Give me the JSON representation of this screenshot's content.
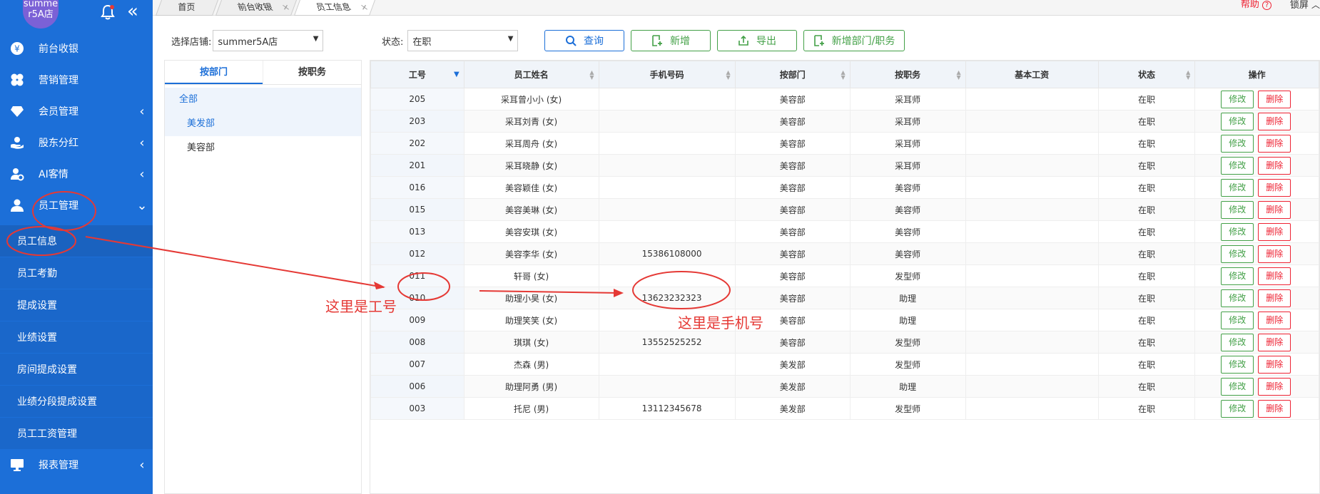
{
  "sidebar": {
    "store_avatar": "summer5A店",
    "avatar_line1": "summe",
    "avatar_line2": "r5A店",
    "bell_icon": "bell-icon",
    "collapse_icon": "double-chevron-left-icon",
    "menu": [
      {
        "label": "前台收银",
        "icon": "yen-icon",
        "arrow": ""
      },
      {
        "label": "营销管理",
        "icon": "clover-icon",
        "arrow": ""
      },
      {
        "label": "会员管理",
        "icon": "diamond-icon",
        "arrow": "‹"
      },
      {
        "label": "股东分红",
        "icon": "hand-coin-icon",
        "arrow": "‹"
      },
      {
        "label": "AI客情",
        "icon": "user-gear-icon",
        "arrow": "‹"
      },
      {
        "label": "员工管理",
        "icon": "user-icon",
        "arrow": "⌄"
      }
    ],
    "submenu": [
      {
        "label": "员工信息"
      },
      {
        "label": "员工考勤"
      },
      {
        "label": "提成设置"
      },
      {
        "label": "业绩设置"
      },
      {
        "label": "房间提成设置"
      },
      {
        "label": "业绩分段提成设置"
      },
      {
        "label": "员工工资管理"
      }
    ],
    "report": {
      "label": "报表管理",
      "icon": "monitor-icon",
      "arrow": "‹"
    }
  },
  "tabs": [
    {
      "label": "首页"
    },
    {
      "label": "前台收银",
      "close": "×"
    },
    {
      "label": "员工信息",
      "close": "×"
    }
  ],
  "topright": {
    "help": "帮助",
    "help_icon": "?",
    "lock": "锁屏"
  },
  "filters": {
    "store_label": "选择店铺:",
    "store_value": "summer5A店",
    "status_label": "状态:",
    "status_value": "在职"
  },
  "buttons": {
    "query": "查询",
    "add": "新增",
    "export": "导出",
    "add_dept": "新增部门/职务"
  },
  "dept_panel": {
    "tab_dept": "按部门",
    "tab_position": "按职务",
    "all": "全部",
    "items": [
      "美发部",
      "美容部"
    ]
  },
  "table": {
    "headers": [
      "工号",
      "员工姓名",
      "手机号码",
      "按部门",
      "按职务",
      "基本工资",
      "状态",
      "操作"
    ],
    "edit_label": "修改",
    "delete_label": "删除",
    "rows": [
      {
        "id": "205",
        "name": "采耳曾小小 (女)",
        "phone": "",
        "dept": "美容部",
        "pos": "采耳师",
        "salary": "",
        "status": "在职"
      },
      {
        "id": "203",
        "name": "采耳刘青 (女)",
        "phone": "",
        "dept": "美容部",
        "pos": "采耳师",
        "salary": "",
        "status": "在职"
      },
      {
        "id": "202",
        "name": "采耳周舟 (女)",
        "phone": "",
        "dept": "美容部",
        "pos": "采耳师",
        "salary": "",
        "status": "在职"
      },
      {
        "id": "201",
        "name": "采耳晓静 (女)",
        "phone": "",
        "dept": "美容部",
        "pos": "采耳师",
        "salary": "",
        "status": "在职"
      },
      {
        "id": "016",
        "name": "美容颖佳 (女)",
        "phone": "",
        "dept": "美容部",
        "pos": "美容师",
        "salary": "",
        "status": "在职"
      },
      {
        "id": "015",
        "name": "美容美琳 (女)",
        "phone": "",
        "dept": "美容部",
        "pos": "美容师",
        "salary": "",
        "status": "在职"
      },
      {
        "id": "013",
        "name": "美容安琪 (女)",
        "phone": "",
        "dept": "美容部",
        "pos": "美容师",
        "salary": "",
        "status": "在职"
      },
      {
        "id": "012",
        "name": "美容李华 (女)",
        "phone": "15386108000",
        "dept": "美容部",
        "pos": "美容师",
        "salary": "",
        "status": "在职"
      },
      {
        "id": "011",
        "name": "轩哥 (女)",
        "phone": "",
        "dept": "美容部",
        "pos": "发型师",
        "salary": "",
        "status": "在职"
      },
      {
        "id": "010",
        "name": "助理小昊 (女)",
        "phone": "13623232323",
        "dept": "美容部",
        "pos": "助理",
        "salary": "",
        "status": "在职"
      },
      {
        "id": "009",
        "name": "助理笑笑 (女)",
        "phone": "",
        "dept": "美容部",
        "pos": "助理",
        "salary": "",
        "status": "在职"
      },
      {
        "id": "008",
        "name": "琪琪 (女)",
        "phone": "13552525252",
        "dept": "美容部",
        "pos": "发型师",
        "salary": "",
        "status": "在职"
      },
      {
        "id": "007",
        "name": "杰森 (男)",
        "phone": "",
        "dept": "美发部",
        "pos": "发型师",
        "salary": "",
        "status": "在职"
      },
      {
        "id": "006",
        "name": "助理阿勇 (男)",
        "phone": "",
        "dept": "美发部",
        "pos": "助理",
        "salary": "",
        "status": "在职"
      },
      {
        "id": "003",
        "name": "托尼 (男)",
        "phone": "13112345678",
        "dept": "美发部",
        "pos": "发型师",
        "salary": "",
        "status": "在职"
      }
    ]
  },
  "annotations": {
    "id_note": "这里是工号",
    "phone_note": "这里是手机号",
    "color": "#e53935"
  }
}
